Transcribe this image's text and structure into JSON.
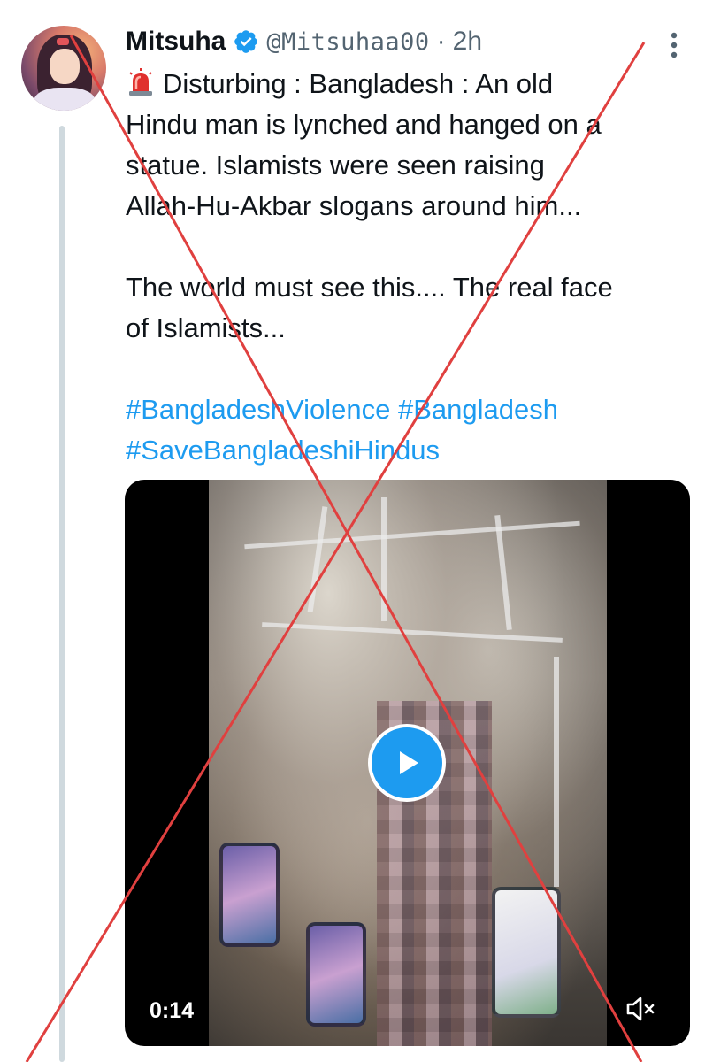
{
  "author": {
    "name": "Mitsuha",
    "handle": "@Mitsuhaa00",
    "separator": "·",
    "time": "2h",
    "verified": true
  },
  "tweet": {
    "emoji": "siren-icon",
    "lines": [
      "Disturbing : Bangladesh : An old",
      "Hindu man is lynched and hanged on a",
      "statue. Islamists were seen raising",
      "Allah-Hu-Akbar slogans around him...",
      "The world must see this.... The real face",
      "of Islamists..."
    ],
    "hashtags": [
      "#BangladeshViolence",
      "#Bangladesh",
      "#SaveBangladeshiHindus"
    ]
  },
  "media": {
    "type": "video",
    "duration": "0:14",
    "muted": true
  },
  "icons": {
    "more": "more-vertical-icon",
    "verified": "verified-badge-icon",
    "play": "play-icon",
    "mute": "volume-muted-icon"
  },
  "colors": {
    "accent": "#1d9bf0",
    "text": "#0f1419",
    "secondary": "#536471",
    "thread_line": "#cfd9de",
    "overlay_cross": "#e0403f"
  }
}
